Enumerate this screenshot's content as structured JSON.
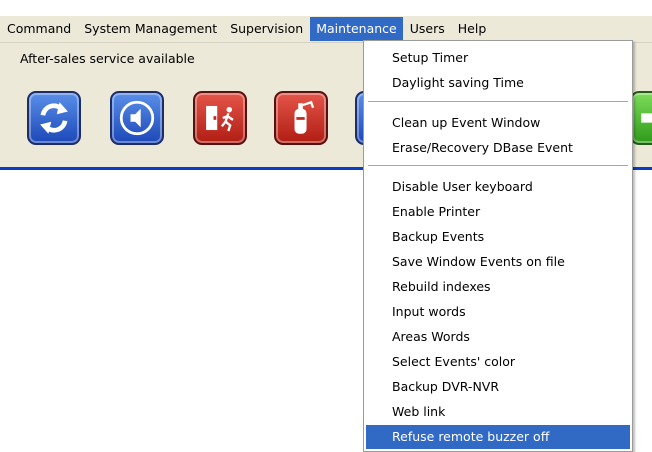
{
  "menubar": {
    "items": [
      "Command",
      "System Management",
      "Supervision",
      "Maintenance",
      "Users",
      "Help"
    ],
    "open_menu": "Maintenance"
  },
  "status": {
    "text": "After-sales service available"
  },
  "toolbar": {
    "buttons": [
      {
        "icon": "refresh-icon",
        "color": "#2a5bd0"
      },
      {
        "icon": "speaker-mute-icon",
        "color": "#2a5bd0"
      },
      {
        "icon": "emergency-exit-icon",
        "color": "#c8281e"
      },
      {
        "icon": "fire-extinguisher-icon",
        "color": "#c8281e"
      }
    ],
    "rule_color": "#0a3dc5"
  },
  "maintenance_menu": {
    "groups": [
      [
        "Setup Timer",
        "Daylight saving Time"
      ],
      [
        "Clean up Event Window",
        "Erase/Recovery DBase Event"
      ],
      [
        "Disable User keyboard",
        "Enable Printer",
        "Backup Events",
        "Save Window Events on file",
        "Rebuild indexes",
        "Input words",
        "Areas Words",
        "Select Events' color",
        "Backup DVR-NVR",
        "Web link",
        "Refuse remote  buzzer off"
      ]
    ],
    "highlighted_item": "Refuse remote  buzzer off",
    "highlight_color": "#316ac5"
  }
}
